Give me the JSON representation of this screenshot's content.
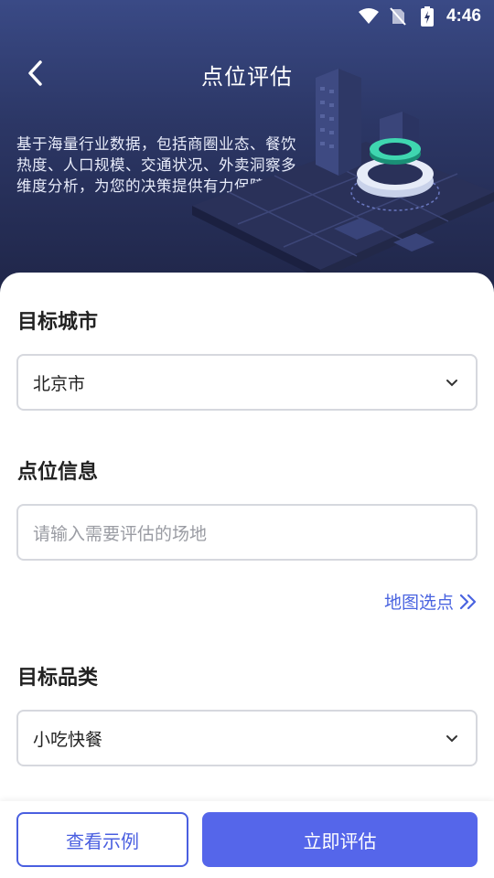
{
  "status_bar": {
    "time": "4:46",
    "icons": [
      "wifi-icon",
      "no-sim-icon",
      "battery-charging-icon"
    ]
  },
  "header": {
    "title": "点位评估",
    "back_icon": "chevron-left-icon",
    "description": "基于海量行业数据，包括商圈业态、餐饮热度、人口规模、交通状况、外卖洞察多维度分析，为您的决策提供有力保障！"
  },
  "form": {
    "city": {
      "label": "目标城市",
      "value": "北京市"
    },
    "location": {
      "label": "点位信息",
      "placeholder": "请输入需要评估的场地"
    },
    "map_pick": {
      "label": "地图选点"
    },
    "category": {
      "label": "目标品类",
      "value": "小吃快餐"
    }
  },
  "actions": {
    "example_label": "查看示例",
    "evaluate_label": "立即评估"
  },
  "colors": {
    "accent": "#5566ea",
    "link": "#4a64e0",
    "hero_top": "#3a4a86",
    "hero_bottom": "#1f2547"
  }
}
